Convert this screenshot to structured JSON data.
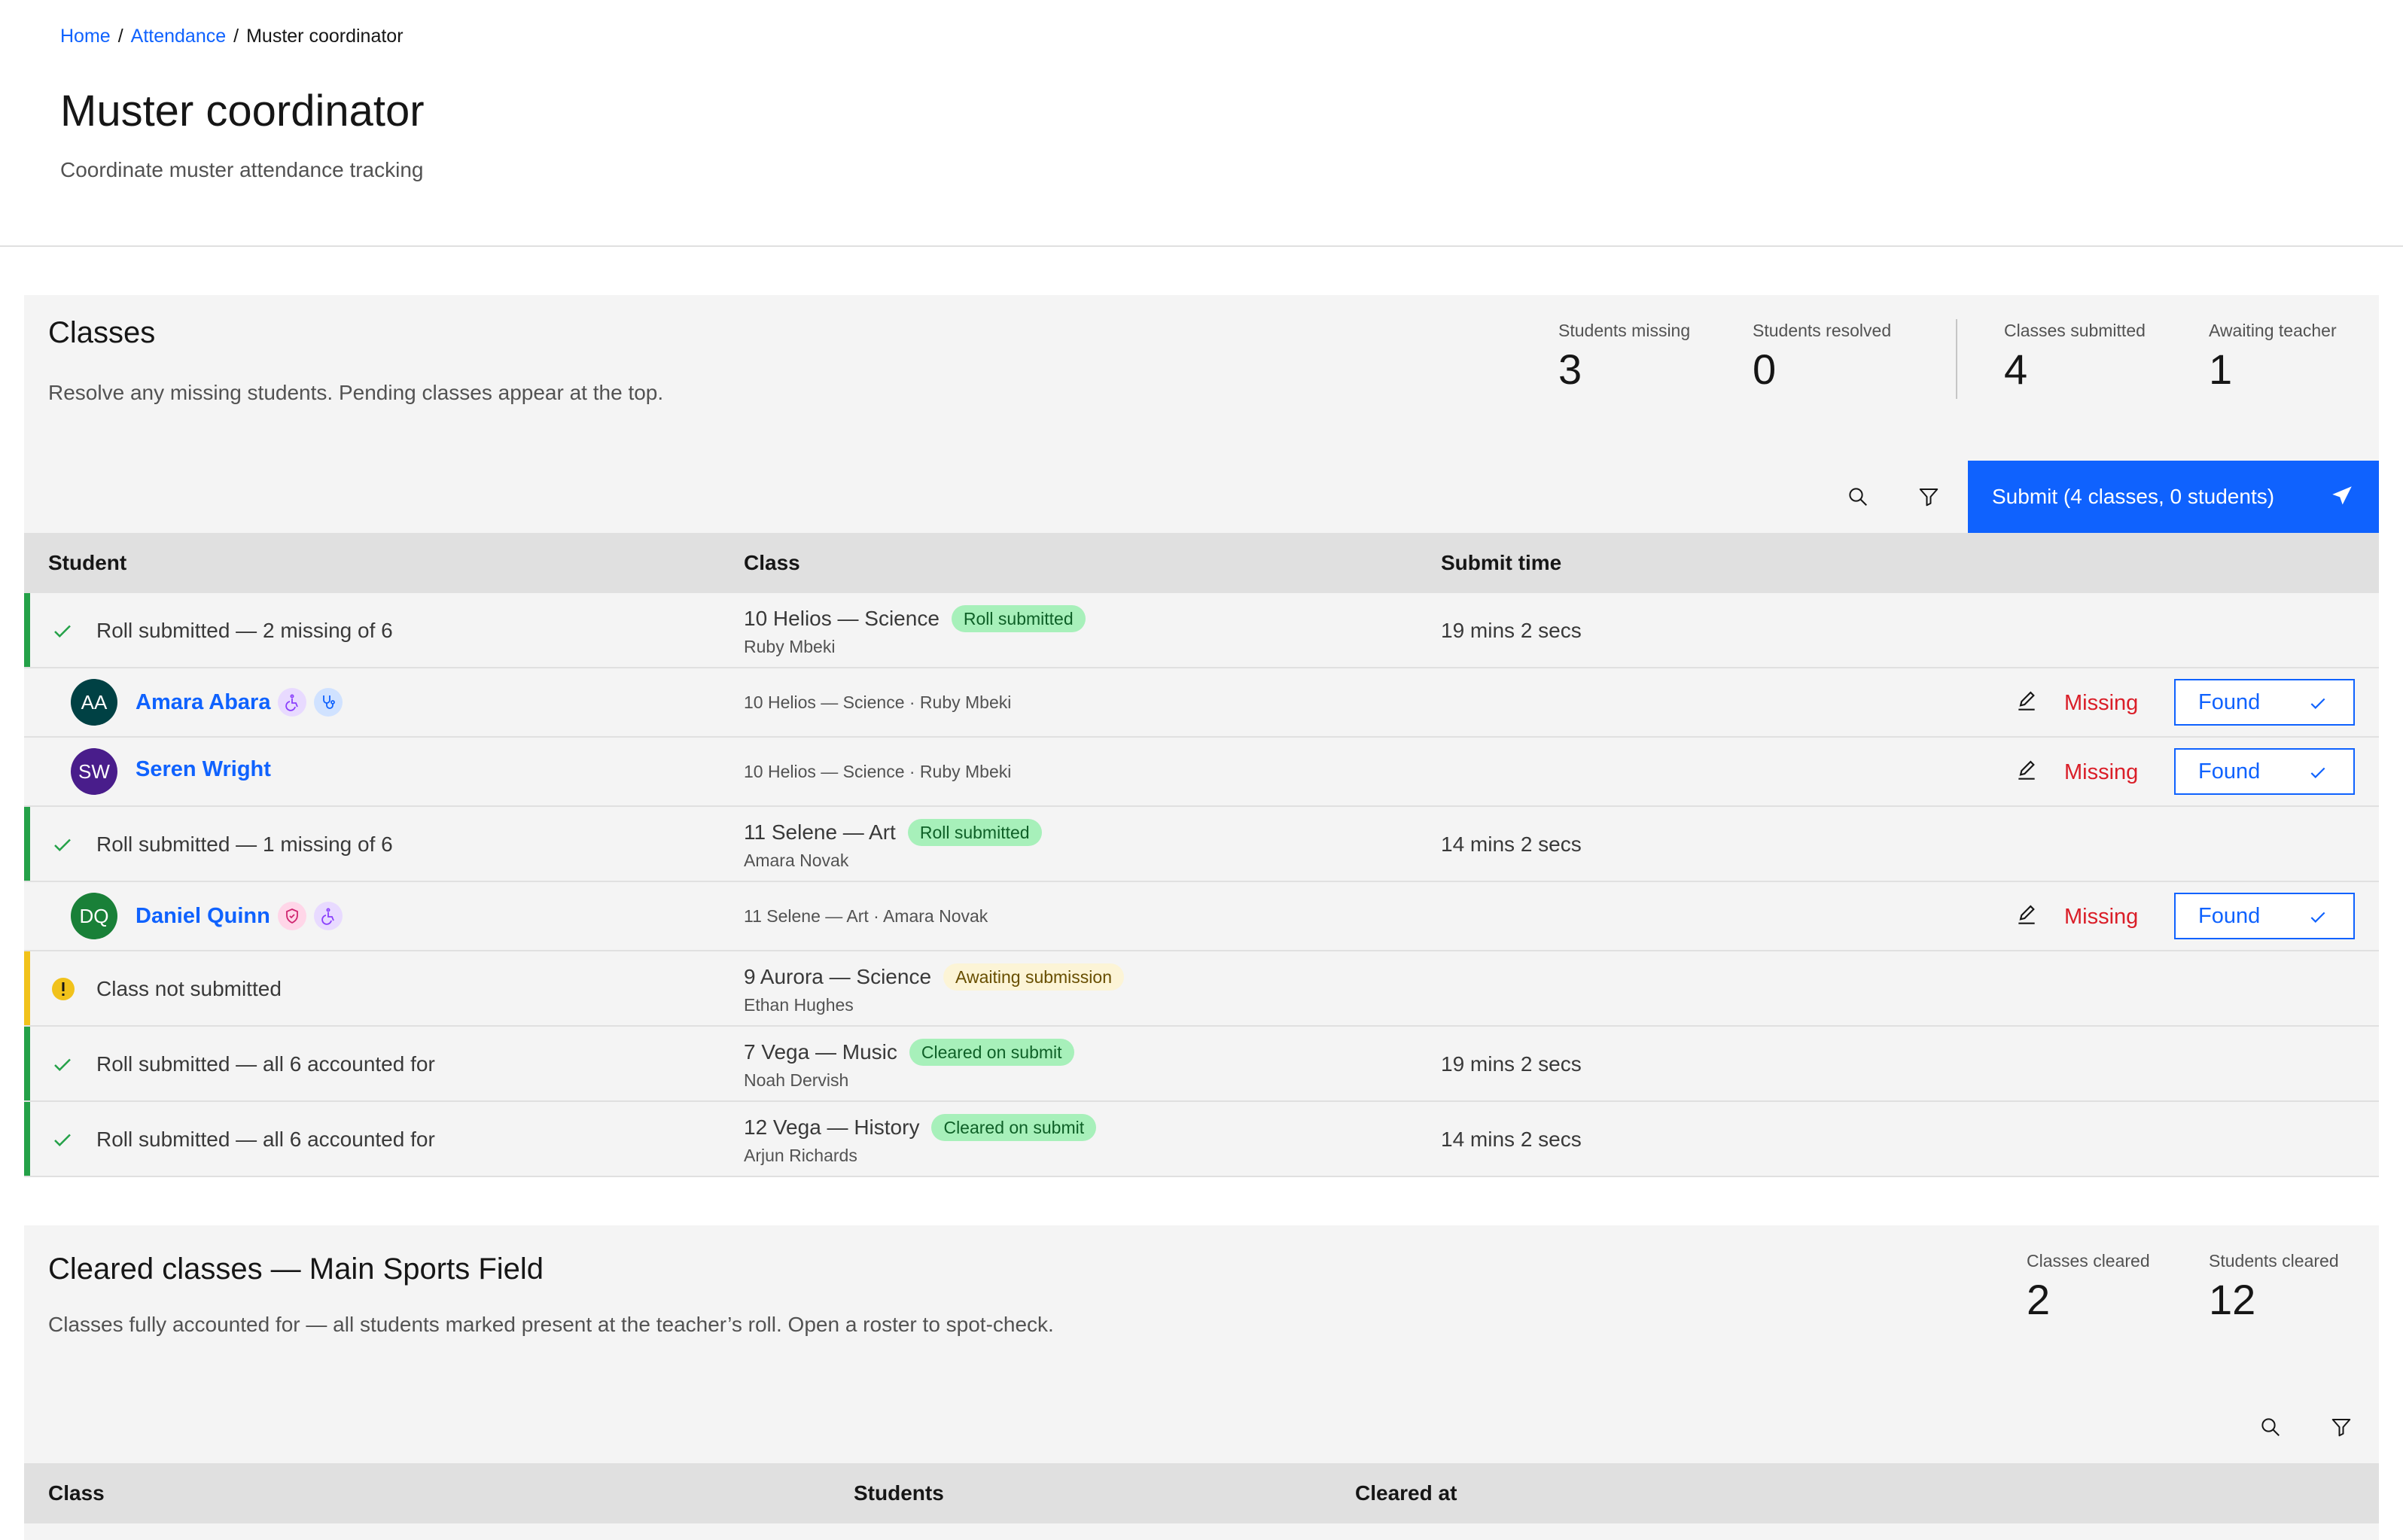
{
  "breadcrumb": {
    "home": "Home",
    "attendance": "Attendance",
    "current": "Muster coordinator",
    "separator": "/"
  },
  "page": {
    "title": "Muster coordinator",
    "subtitle": "Coordinate muster attendance tracking"
  },
  "classes_panel": {
    "title": "Classes",
    "description": "Resolve any missing students. Pending classes appear at the top.",
    "stats": [
      {
        "label": "Students missing",
        "value": "3"
      },
      {
        "label": "Students resolved",
        "value": "0"
      },
      {
        "label": "Classes submitted",
        "value": "4"
      },
      {
        "label": "Awaiting teacher",
        "value": "1"
      }
    ],
    "submit_label": "Submit (4 classes, 0 students)",
    "columns": {
      "student": "Student",
      "class": "Class",
      "submit_time": "Submit time"
    },
    "rows": [
      {
        "status": "Roll submitted — 2 missing of 6",
        "class_name": "10 Helios — Science",
        "tag": "Roll submitted",
        "teacher": "Ruby Mbeki",
        "time": "19 mins 2 secs"
      },
      {
        "status": "Roll submitted — 1 missing of 6",
        "class_name": "11 Selene — Art",
        "tag": "Roll submitted",
        "teacher": "Amara Novak",
        "time": "14 mins 2 secs"
      },
      {
        "status": "Class not submitted",
        "class_name": "9 Aurora — Science",
        "tag": "Awaiting submission",
        "teacher": "Ethan Hughes",
        "time": ""
      },
      {
        "status": "Roll submitted — all 6 accounted for",
        "class_name": "7 Vega — Music",
        "tag": "Cleared on submit",
        "teacher": "Noah Dervish",
        "time": "19 mins 2 secs"
      },
      {
        "status": "Roll submitted — all 6 accounted for",
        "class_name": "12 Vega — History",
        "tag": "Cleared on submit",
        "teacher": "Arjun Richards",
        "time": "14 mins 2 secs"
      }
    ],
    "students": [
      {
        "initials": "AA",
        "name": "Amara Abara",
        "class_line": "10 Helios — Science · Ruby Mbeki",
        "missing": "Missing",
        "found": "Found",
        "avatar_color": "#004144"
      },
      {
        "initials": "SW",
        "name": "Seren Wright",
        "class_line": "10 Helios — Science · Ruby Mbeki",
        "missing": "Missing",
        "found": "Found",
        "avatar_color": "#491d8b"
      },
      {
        "initials": "DQ",
        "name": "Daniel Quinn",
        "class_line": "11 Selene — Art · Amara Novak",
        "missing": "Missing",
        "found": "Found",
        "avatar_color": "#198038"
      }
    ]
  },
  "cleared_panel": {
    "title": "Cleared classes — Main Sports Field",
    "description": "Classes fully accounted for — all students marked present at the teacher’s roll. Open a roster to spot-check.",
    "stats": [
      {
        "label": "Classes cleared",
        "value": "2"
      },
      {
        "label": "Students cleared",
        "value": "12"
      }
    ],
    "columns": {
      "class": "Class",
      "students": "Students",
      "cleared_at": "Cleared at"
    }
  }
}
